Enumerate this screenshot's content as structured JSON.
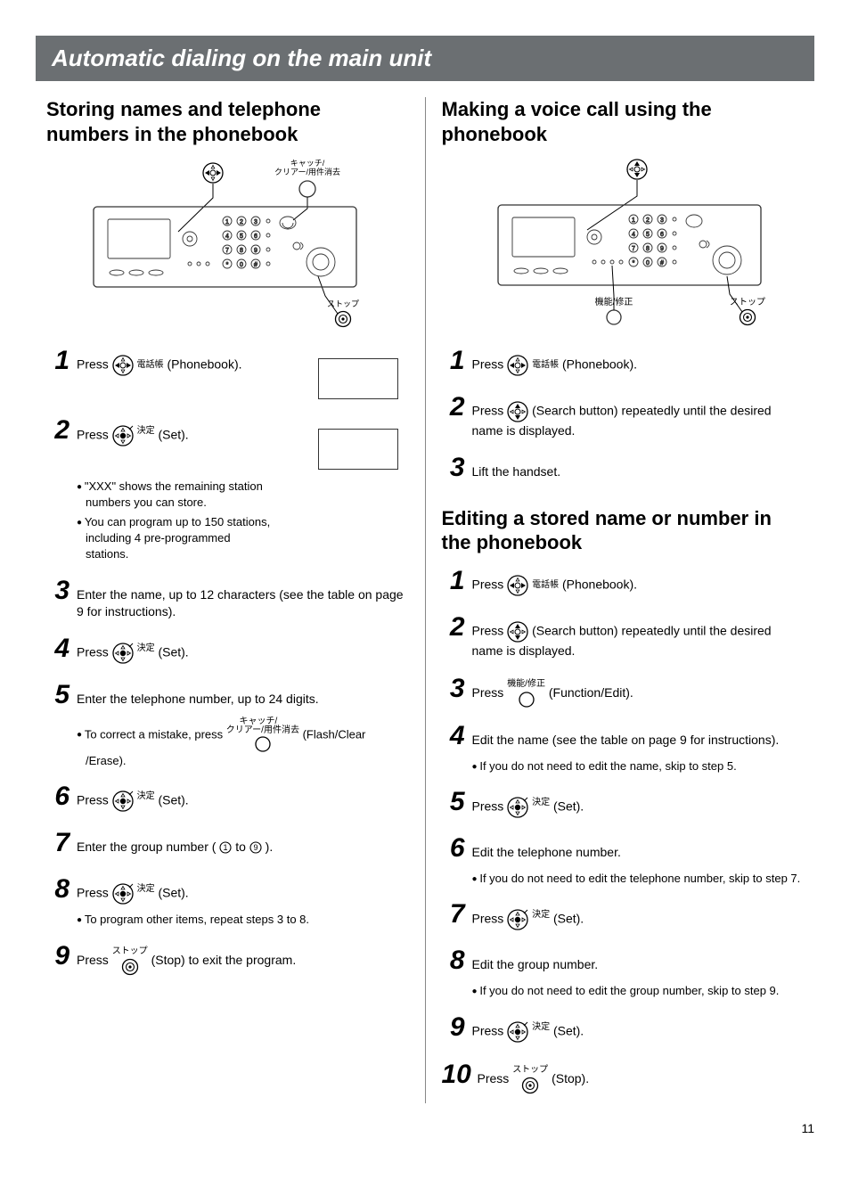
{
  "title": "Automatic dialing on the main unit",
  "page_number": "11",
  "left": {
    "heading": "Storing names and telephone numbers in the phonebook",
    "outer_labels": {
      "flash_clear": "キャッチ/\nクリアー/用件消去",
      "stop": "ストップ"
    },
    "steps": {
      "1": {
        "press": "Press ",
        "label_jp": "電話帳",
        "label_en": " (Phonebook)."
      },
      "2": {
        "press": "Press ",
        "btn_jp": "決定",
        "btn_en": " (Set).",
        "bullets": [
          "\"XXX\" shows the remaining station numbers you can store.",
          "You can program up to 150 stations, including 4 pre-programmed stations."
        ]
      },
      "3": {
        "text": "Enter the name, up to 12 characters (see the table on page 9 for instructions)."
      },
      "4": {
        "press": "Press ",
        "btn_jp": "決定",
        "btn_en": " (Set)."
      },
      "5": {
        "text": "Enter the telephone number, up to 24 digits.",
        "bullet_pre": "To correct a mistake, press ",
        "bullet_jp": "キャッチ/\nクリアー/用件消去",
        "bullet_post": " (Flash/Clear /Erase)."
      },
      "6": {
        "press": "Press ",
        "btn_jp": "決定",
        "btn_en": " (Set)."
      },
      "7": {
        "pre": "Enter the group number (",
        "mid": " to ",
        "post": ")."
      },
      "8": {
        "press": "Press ",
        "btn_jp": "決定",
        "btn_en": " (Set).",
        "bullet": "To program other items, repeat steps 3 to 8."
      },
      "9": {
        "press": "Press ",
        "btn_jp": "ストップ",
        "btn_en": " (Stop) to exit the program."
      }
    }
  },
  "right": {
    "heading_a": "Making a voice call using the phonebook",
    "outer_labels": {
      "func_edit": "機能/修正",
      "stop": "ストップ"
    },
    "steps_a": {
      "1": {
        "press": "Press ",
        "label_jp": "電話帳",
        "label_en": " (Phonebook)."
      },
      "2": {
        "press": "Press ",
        "label_en": " (Search button) repeatedly until the desired name is displayed."
      },
      "3": {
        "text": "Lift the handset."
      }
    },
    "heading_b": "Editing a stored name or number in the phonebook",
    "steps_b": {
      "1": {
        "press": "Press ",
        "label_jp": "電話帳",
        "label_en": " (Phonebook)."
      },
      "2": {
        "press": "Press ",
        "label_en": " (Search button) repeatedly until the desired name is displayed."
      },
      "3": {
        "press": "Press ",
        "btn_jp": "機能/修正",
        "btn_en": " (Function/Edit)."
      },
      "4": {
        "text": "Edit the name (see the table on page 9 for instructions).",
        "bullet": "If you do not need to edit the name, skip to step 5."
      },
      "5": {
        "press": "Press ",
        "btn_jp": "決定",
        "btn_en": " (Set)."
      },
      "6": {
        "text": "Edit the telephone number.",
        "bullet": "If you do not need to edit the telephone number, skip to step 7."
      },
      "7": {
        "press": "Press ",
        "btn_jp": "決定",
        "btn_en": " (Set)."
      },
      "8": {
        "text": "Edit the group number.",
        "bullet": "If you do not need to edit the group number, skip to step 9."
      },
      "9": {
        "press": "Press ",
        "btn_jp": "決定",
        "btn_en": " (Set)."
      },
      "10": {
        "press": "Press ",
        "btn_jp": "ストップ",
        "btn_en": " (Stop)."
      }
    }
  }
}
